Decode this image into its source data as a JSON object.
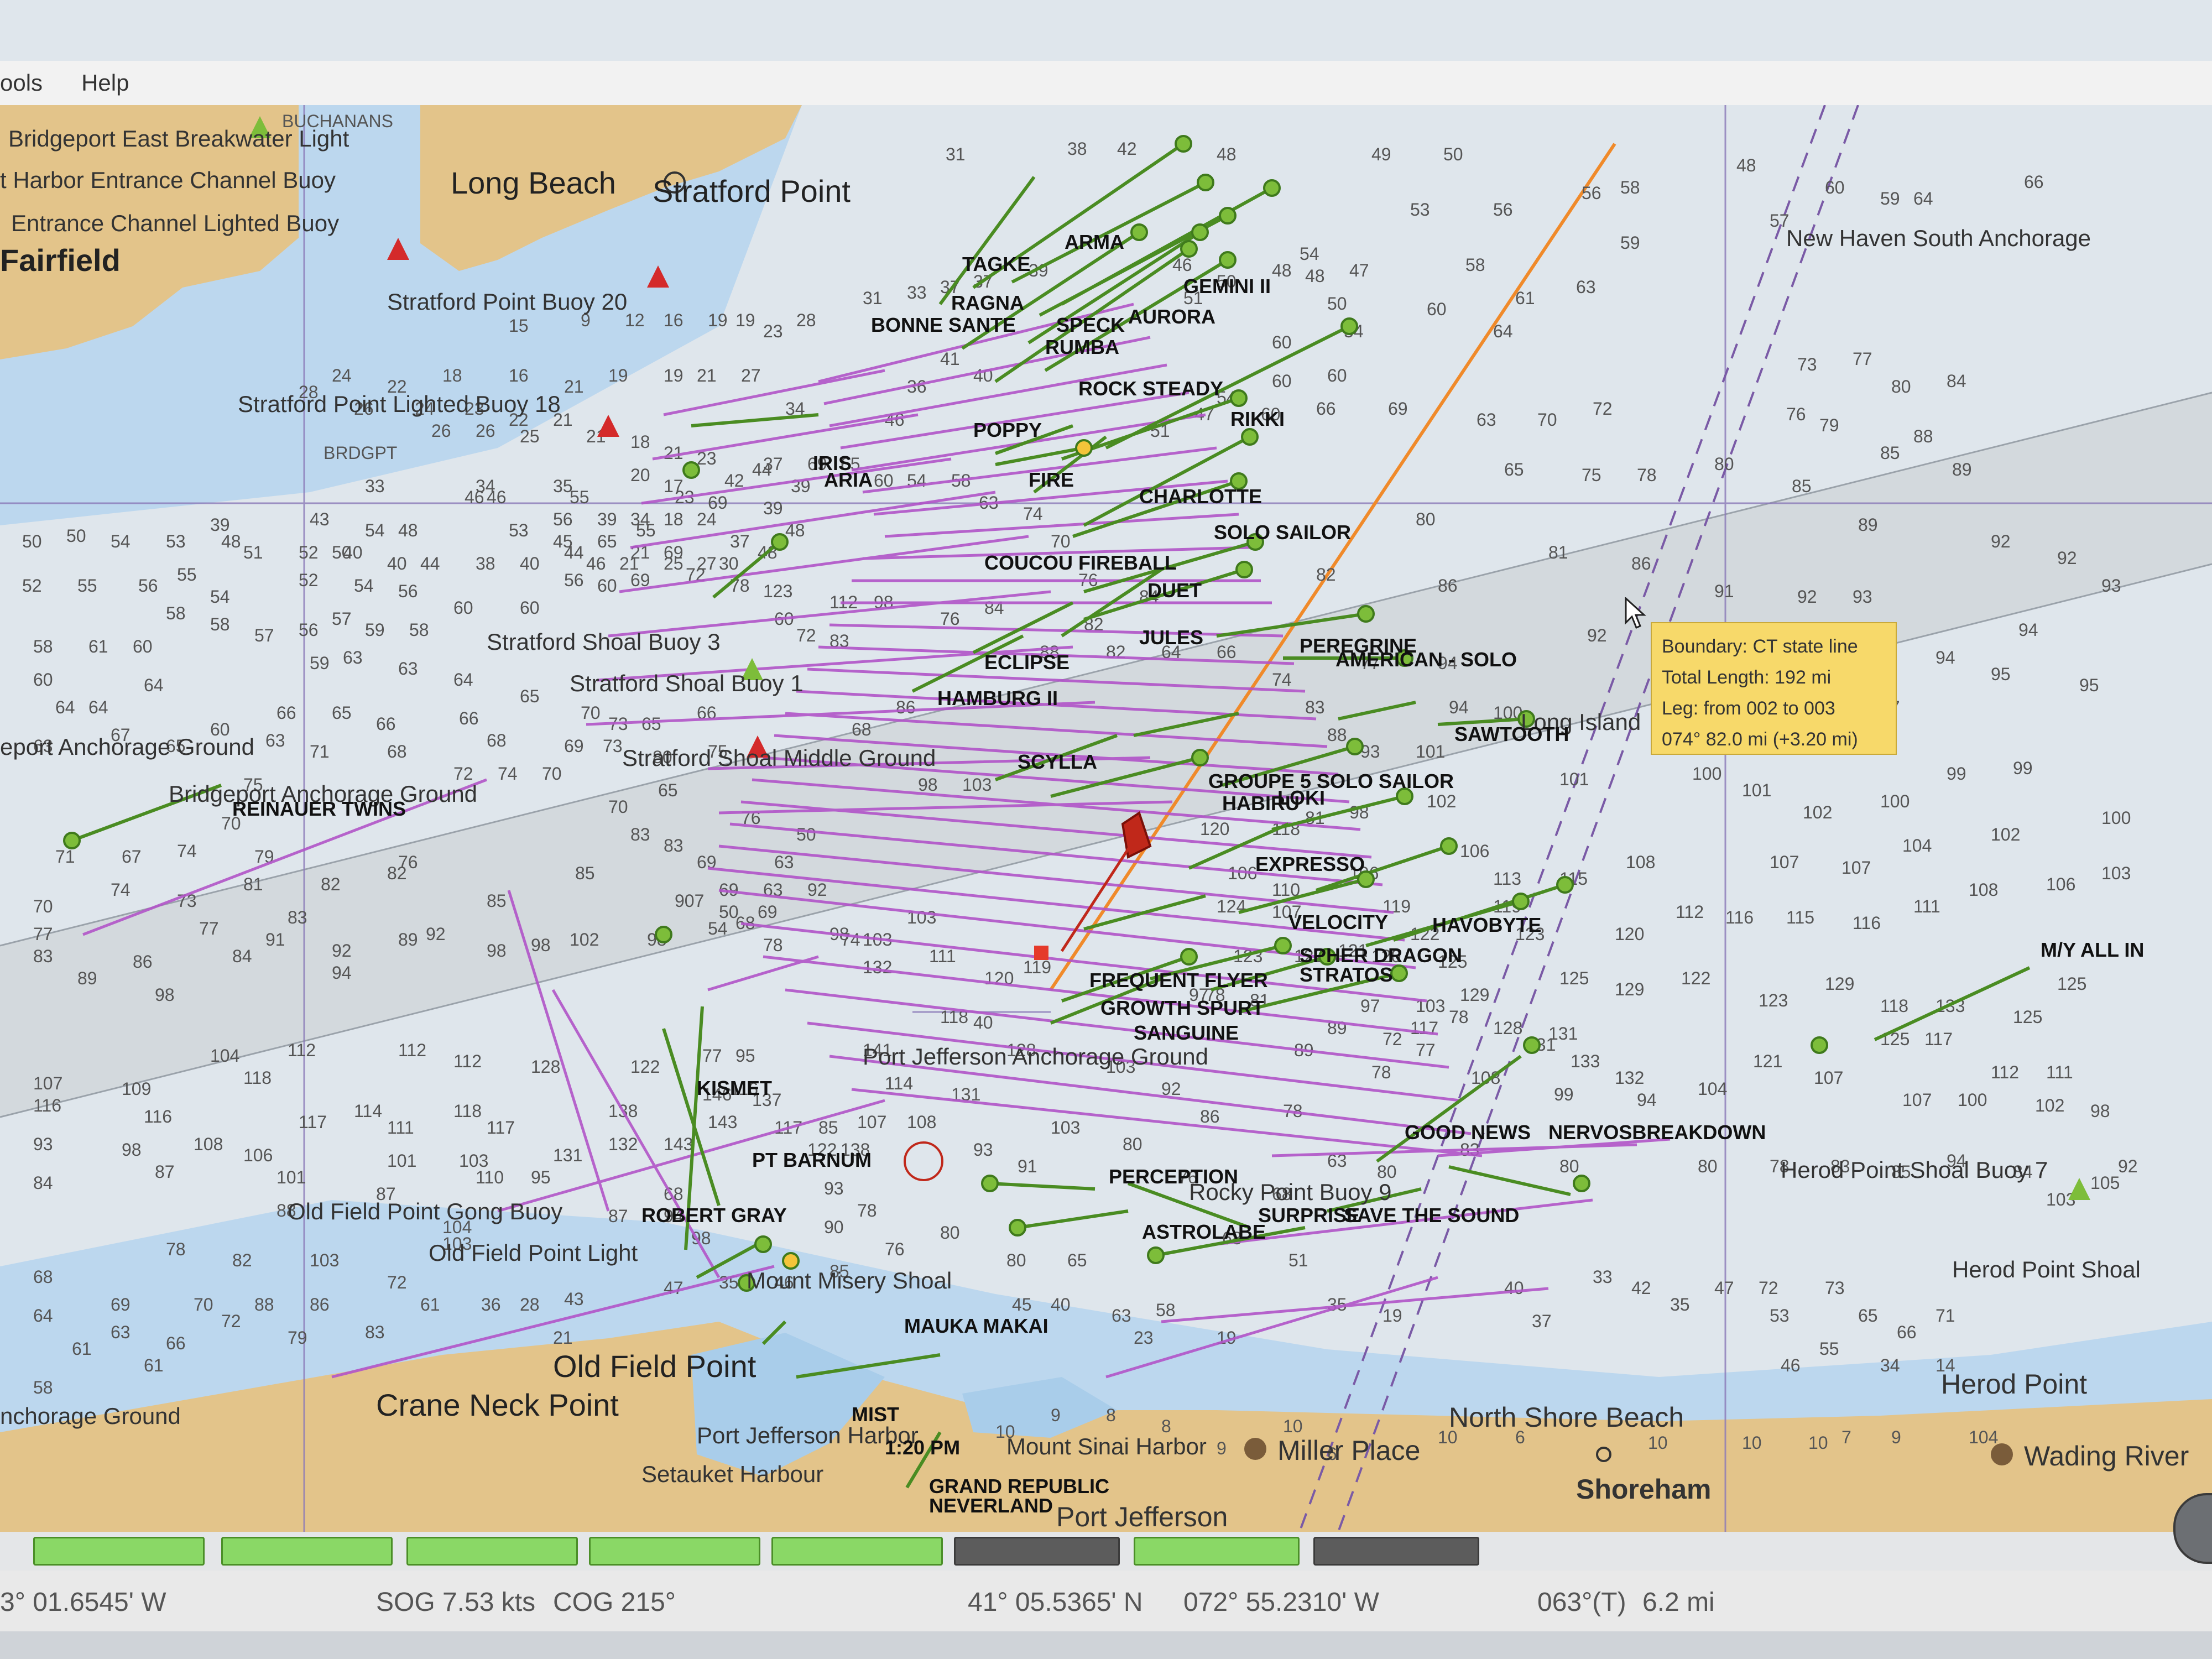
{
  "menu": [
    "ools",
    "Help"
  ],
  "map": {
    "places": [
      {
        "name": "Long Beach"
      },
      {
        "name": "Stratford Point"
      },
      {
        "name": "Fairfield"
      },
      {
        "name": "Crane Neck Point"
      },
      {
        "name": "Old Field Point"
      },
      {
        "name": "Port Jefferson"
      },
      {
        "name": "Miller Place"
      },
      {
        "name": "Shoreham"
      },
      {
        "name": "North Shore Beach"
      },
      {
        "name": "Wading River"
      },
      {
        "name": "Herod Point"
      },
      {
        "name": "Setauket Harbour"
      },
      {
        "name": "Mount Sinai Harbor"
      },
      {
        "name": "Port Jefferson Harbor"
      }
    ],
    "features": [
      "Bridgeport East Breakwater Light",
      "t Harbor Entrance Channel Buoy",
      "Entrance Channel Lighted Buoy",
      "Stratford Point Buoy 20",
      "Stratford Point Lighted Buoy 18",
      "Stratford Shoal Buoy 3",
      "Stratford Shoal Buoy 1",
      "Stratford Shoal Middle Ground",
      "eport Anchorage Ground",
      "Bridgeport Anchorage Ground",
      "Port Jefferson Anchorage Ground",
      "Old Field Point Gong Buoy",
      "Old Field Point Light",
      "Mount Misery Shoal",
      "Rocky Point Buoy 9",
      "Herod Point Shoal Buoy 7",
      "Herod Point Shoal",
      "New Haven South Anchorage",
      "Long Island",
      "BUCHANANS",
      "BRDGPT",
      "nchorage Ground"
    ],
    "boats": [
      "ARMA",
      "GEMINI II",
      "RAGNA",
      "TAGKE",
      "BONNE SANTE",
      "AURORA",
      "SPECK",
      "RUMBA",
      "ROCK STEADY",
      "RIKKI",
      "POPPY",
      "IRIS",
      "ARIA",
      "FIRE",
      "CHARLOTTE",
      "SOLO SAILOR",
      "COUCOU",
      "FIREBALL",
      "DUET",
      "JULES",
      "PEREGRINE",
      "AMERICAN - SOLO",
      "ECLIPSE",
      "HAMBURG II",
      "SAWTOOTH",
      "SCYLLA",
      "GROUPE 5 SOLO SAILOR",
      "HABIRU",
      "LOKI",
      "EXPRESSO",
      "HAVOBYTE",
      "VELOCITY",
      "SPHER DRAGON",
      "STRATOS",
      "FREQUENT FLYER",
      "GROWTH SPURT",
      "SANGUINE",
      "KISMET",
      "PT BARNUM",
      "ROBERT GRAY",
      "PERCEPTION",
      "SURPRISE",
      "SAVE THE SOUND",
      "ASTROLABE",
      "GOOD NEWS",
      "NERVOSBREAKDOWN",
      "M/Y ALL IN",
      "REINAUER TWINS",
      "MAUKA MAKAI",
      "GRAND REPUBLIC",
      "NEVERLAND",
      "MIST",
      "1:20 PM"
    ],
    "colors": {
      "water": "#dfe6ec",
      "shallow": "#a9cdea",
      "land": "#e3c48a",
      "track": "#b154c8",
      "vessel": "#7dbd3a",
      "course": "#f08a2a",
      "boundary": "#7a5aa6"
    }
  },
  "tooltip": {
    "line1": "Boundary: CT state line",
    "line2": "Total Length: 192 mi",
    "line3": "Leg: from 002 to 003",
    "line4": "074°  82.0 mi (+3.20 mi)"
  },
  "progress_segments": [
    true,
    true,
    true,
    true,
    true,
    false,
    true,
    false
  ],
  "status": {
    "lon_left": "3° 01.6545' W",
    "sog": "SOG 7.53 kts",
    "cog": "COG 215°",
    "lat": "41° 05.5365' N",
    "lon": "072° 55.2310' W",
    "bearing": "063°(T)",
    "distance": "6.2 mi"
  }
}
